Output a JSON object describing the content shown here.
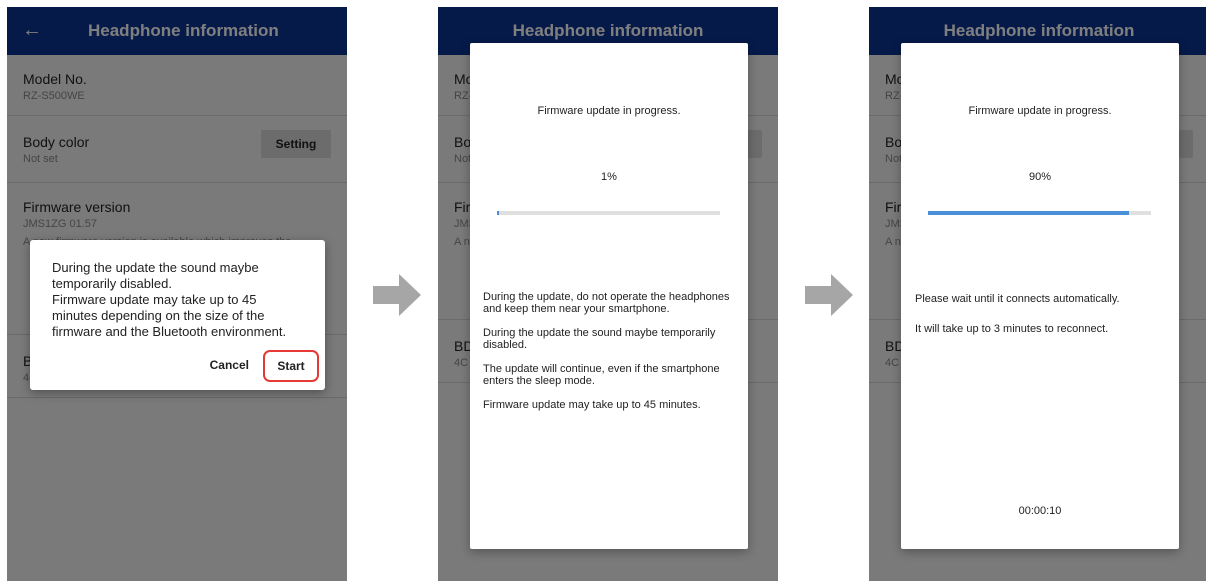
{
  "app_bar": {
    "title": "Headphone information"
  },
  "settings": {
    "model_label": "Model No.",
    "model_value": "RZ-S500WE",
    "body_color_label": "Body color",
    "body_color_value": "Not set",
    "setting_button": "Setting",
    "firmware_label": "Firmware version",
    "firmware_value": "JMS1ZG 01.57",
    "firmware_desc": "A new firmware version is available which improves the",
    "bd_label": "BD",
    "bd_value": "4C"
  },
  "confirm_dialog": {
    "line1": "During the update the sound maybe",
    "line2": "temporarily disabled.",
    "line3": "Firmware update may take up to 45",
    "line4": "minutes depending on the size of the",
    "line5": "firmware and the Bluetooth environment.",
    "cancel": "Cancel",
    "start": "Start"
  },
  "update_screen_1": {
    "title": "Firmware update in progress.",
    "percent_text": "1%",
    "progress": 0.01,
    "note1": "During the update, do not operate the headphones and keep them near your smartphone.",
    "note2": "During the update the sound maybe temporarily disabled.",
    "note3": "The update will continue, even if the smartphone enters the sleep mode.",
    "note4": "Firmware update may take up to 45 minutes."
  },
  "update_screen_2": {
    "title": "Firmware update in progress.",
    "percent_text": "90%",
    "progress": 0.9,
    "wait1": "Please wait until it connects automatically.",
    "wait2": "It will take up to 3 minutes to reconnect.",
    "timer": "00:00:10"
  },
  "icons": {
    "back": "arrow-left-icon",
    "step_arrow": "arrow-right-icon"
  },
  "colors": {
    "app_bar": "#0d3594",
    "progress": "#4a90d9",
    "highlight": "#e53935",
    "step_arrow": "#a6a6a6"
  }
}
